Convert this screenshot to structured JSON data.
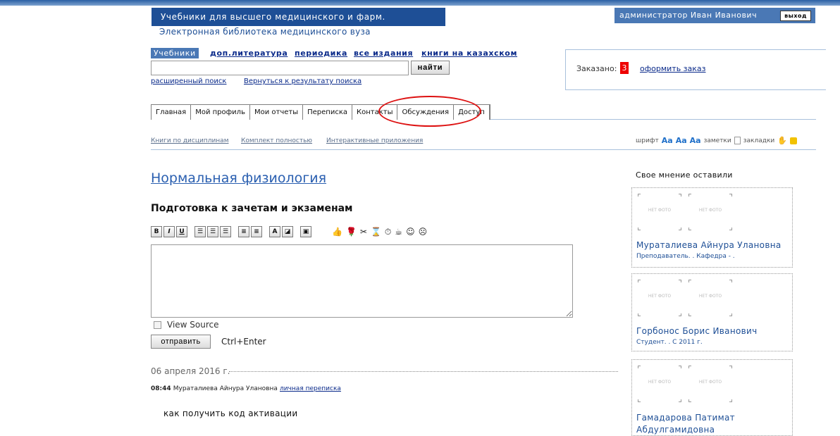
{
  "header": {
    "brand_title": "Учебники для высшего медицинского и фарм. образования",
    "brand_subtitle": "Электронная библиотека медицинского вуза",
    "user_name": "администратор Иван Иванович",
    "logout_label": "выход"
  },
  "categories": {
    "active": "Учебники",
    "items": [
      "доп.литература",
      "периодика",
      "все издания",
      "книги на казахском"
    ]
  },
  "search": {
    "value": "",
    "button_label": "найти",
    "advanced_link": "расширенный поиск",
    "back_link": "Вернуться к результату поиска"
  },
  "order": {
    "label": "Заказано:",
    "count": "3",
    "link": "оформить заказ"
  },
  "nav": {
    "tabs": [
      "Главная",
      "Мой профиль",
      "Мои отчеты",
      "Переписка",
      "Контакты",
      "Обсуждения",
      "Доступ"
    ],
    "highlighted_tab": "Обсуждения"
  },
  "secondary_nav": {
    "items": [
      "Книги по дисциплинам",
      "Комплект полностью",
      "Интерактивные приложения"
    ]
  },
  "tools": {
    "font_label": "шрифт",
    "notes_label": "заметки",
    "bookmarks_label": "закладки",
    "font_buttons": [
      "Aa",
      "Aa",
      "Aa"
    ]
  },
  "page": {
    "book_title": "Нормальная физиология",
    "section_title": "Подготовка к зачетам и экзаменам"
  },
  "editor": {
    "format_buttons": [
      "B",
      "I",
      "U"
    ],
    "view_source_label": "View Source",
    "send_label": "отправить",
    "hint": "Ctrl+Enter"
  },
  "messages": [
    {
      "date": "06 апреля 2016 г.",
      "time": "08:44",
      "author": "Мураталиева Айнура Улановна",
      "link": "личная переписка",
      "text": "как получить код активации"
    }
  ],
  "sidebar": {
    "title": "Свое мнение оставили",
    "photo_placeholder": "НЕТ ФОТО",
    "users": [
      {
        "name": "Мураталиева Айнура Улановна",
        "role": "Преподаватель. . Кафедра - ."
      },
      {
        "name": "Горбонос Борис Иванович",
        "role": "Студент. . С 2011 г."
      },
      {
        "name": "Гамадарова Патимат Абдулгамидовна",
        "role": ""
      }
    ]
  },
  "colors": {
    "brand": "#1e4f96",
    "userbar": "#4a78b5",
    "link": "#0a2a8a",
    "order_badge": "#ee0000",
    "highlight": "#dd1111"
  }
}
